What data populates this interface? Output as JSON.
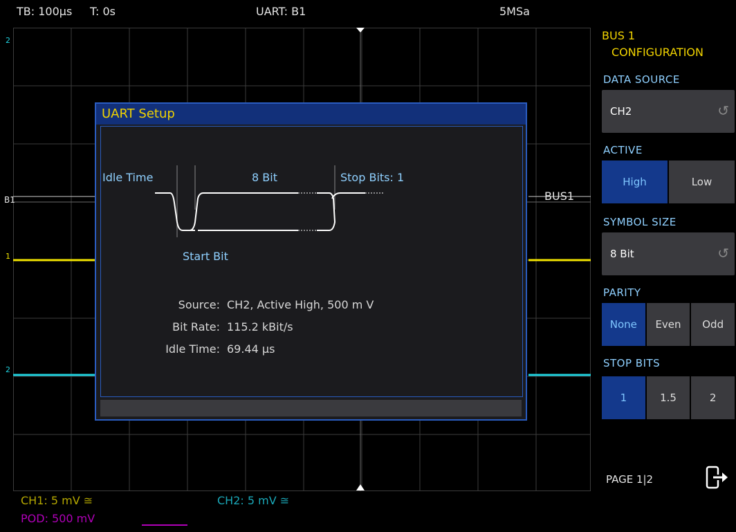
{
  "status": {
    "timebase": "TB: 100µs",
    "trigger_time": "T: 0s",
    "protocol": "UART: B1",
    "sample_rate": "5MSa"
  },
  "traces": {
    "ch1_marker": "1",
    "ch2_marker": "2",
    "bus_marker": "B1",
    "bus_label": "BUS1",
    "ch1_color": "#f2e400",
    "ch2_color": "#1fd3e0"
  },
  "dialog": {
    "title": "UART Setup",
    "diagram": {
      "idle_time": "Idle Time",
      "data_bits": "8 Bit",
      "stop_bits": "Stop Bits: 1",
      "start_bit": "Start Bit"
    },
    "info": [
      {
        "key": "Source:",
        "value": "CH2, Active High, 500 m V"
      },
      {
        "key": "Bit Rate:",
        "value": "115.2 kBit/s"
      },
      {
        "key": "Idle Time:",
        "value": "69.44 µs"
      }
    ]
  },
  "channels": {
    "ch1": "CH1: 5 mV ≅",
    "ch2": "CH2: 5 mV ≅",
    "pod": "POD: 500 mV",
    "ch1_color": "#b5a800",
    "ch2_color": "#1aa8b8",
    "pod_color": "#b000b8"
  },
  "menu": {
    "title_line1": "BUS 1",
    "title_line2": "CONFIGURATION",
    "data_source": {
      "label": "DATA SOURCE",
      "value": "CH2"
    },
    "active": {
      "label": "ACTIVE",
      "options": [
        "High",
        "Low"
      ],
      "selected": "High"
    },
    "symbol_size": {
      "label": "SYMBOL SIZE",
      "value": "8 Bit"
    },
    "parity": {
      "label": "PARITY",
      "options": [
        "None",
        "Even",
        "Odd"
      ],
      "selected": "None"
    },
    "stop_bits": {
      "label": "STOP BITS",
      "options": [
        "1",
        "1.5",
        "2"
      ],
      "selected": "1"
    },
    "page": "PAGE 1|2",
    "exit_icon": "exit-arrow-icon"
  }
}
